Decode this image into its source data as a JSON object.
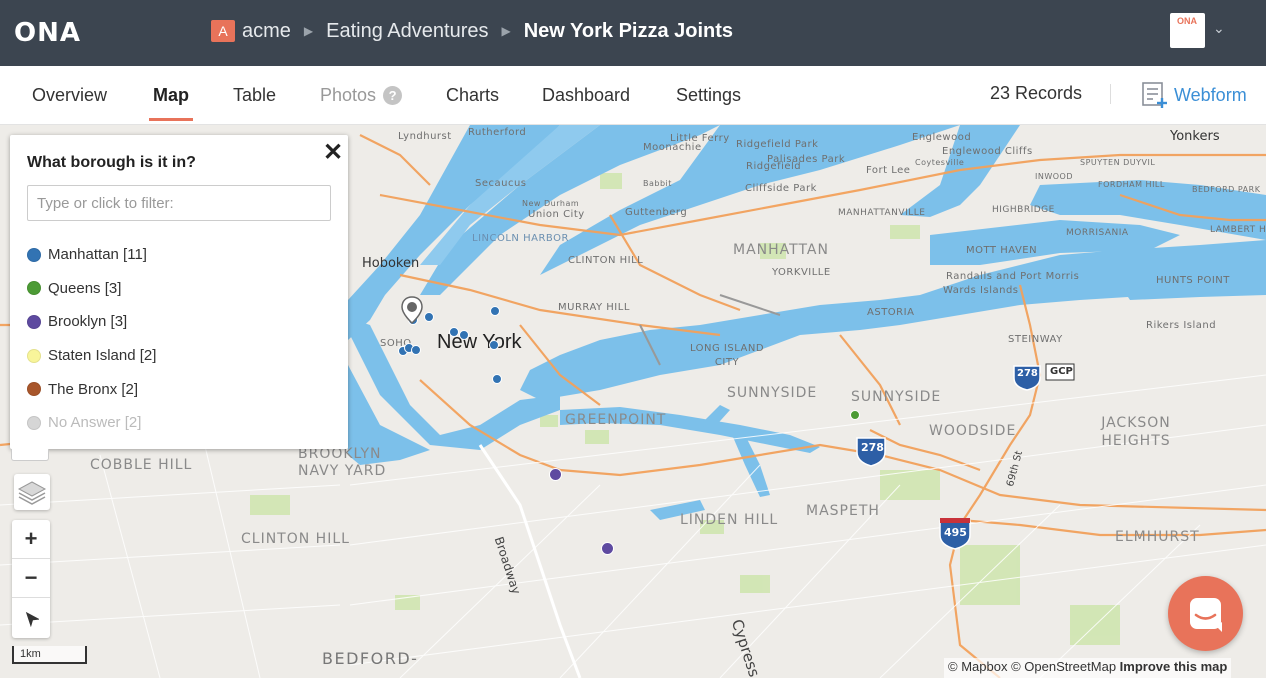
{
  "app": {
    "logo": "ONA",
    "breadcrumbs": {
      "org_initial": "A",
      "org": "acme",
      "project": "Eating Adventures",
      "form": "New York Pizza Joints"
    }
  },
  "tabs": {
    "overview": "Overview",
    "map": "Map",
    "table": "Table",
    "photos": "Photos",
    "photos_help": "?",
    "charts": "Charts",
    "dashboard": "Dashboard",
    "settings": "Settings"
  },
  "records": "23 Records",
  "webform": "Webform",
  "filter": {
    "title": "What borough is it in?",
    "close": "✕",
    "placeholder": "Type or click to filter:",
    "items": [
      {
        "label": "Manhattan [11]",
        "color": "#3273b3"
      },
      {
        "label": "Queens [3]",
        "color": "#4c9b35"
      },
      {
        "label": "Brooklyn [3]",
        "color": "#5e4aa0"
      },
      {
        "label": "Staten Island [2]",
        "color": "#f8f59a"
      },
      {
        "label": "The Bronx [2]",
        "color": "#a8562b"
      },
      {
        "label": "No Answer [2]",
        "color": "#d6d6d6"
      }
    ]
  },
  "map": {
    "city_label": "New York",
    "labels": {
      "lyndhurst": "Lyndhurst",
      "rutherford": "Rutherford",
      "little_ferry": "Little Ferry",
      "moonachie": "Moonachie",
      "ridgefield_park": "Ridgefield Park",
      "englewood": "Englewood",
      "englewood_cliffs": "Englewood Cliffs",
      "yonkers": "Yonkers",
      "ridgefield": "Ridgefield",
      "palisades_park": "Palisades Park",
      "fort_lee": "Fort Lee",
      "coytesville": "Coytesville",
      "secaucus": "Secaucus",
      "babbit": "Babbit",
      "cliffside_park": "Cliffside Park",
      "new_durham": "New Durham",
      "union_city": "Union City",
      "guttenberg": "Guttenberg",
      "manhattanville": "MANHATTANVILLE",
      "highbridge": "HIGHBRIDGE",
      "morrisania": "MORRISANIA",
      "inwood": "INWOOD",
      "spuyten_duyvil": "SPUYTEN DUYVIL",
      "fordham_hill": "FORDHAM HILL",
      "bedford_park": "BEDFORD PARK",
      "lambert_houses": "LAMBERT HOUSES",
      "lincoln_harbor": "LINCOLN HARBOR",
      "hoboken": "Hoboken",
      "clinton_hill_nj": "CLINTON HILL",
      "manhattan": "MANHATTAN",
      "yorkville": "YORKVILLE",
      "mott_haven": "MOTT HAVEN",
      "randalls": "Randalls and Port Morris",
      "wards": "Wards Islands",
      "hunts_point": "HUNTS POINT",
      "murray_hill": "MURRAY HILL",
      "astoria": "ASTORIA",
      "rikers": "Rikers Island",
      "steinway": "STEINWAY",
      "soho": "SOHO",
      "long_island_city": "LONG ISLAND CITY",
      "sunnyside": "SUNNYSIDE",
      "sunnyside2": "SUNNYSIDE",
      "greenpoint": "GREENPOINT",
      "woodside": "WOODSIDE",
      "jackson_heights": "JACKSON HEIGHTS",
      "brooklyn_navy_yard": "BROOKLYN NAVY YARD",
      "cobble_hill": "COBBLE HILL",
      "linden_hill": "LINDEN HILL",
      "maspeth": "MASPETH",
      "elmhurst": "ELMHURST",
      "clinton_hill": "CLINTON HILL",
      "bedford": "BEDFORD-",
      "broadway": "Broadway",
      "cypress": "Cypress",
      "st_69": "69th St",
      "i495": "495",
      "i278": "278",
      "i278b": "278",
      "gcp": "GCP"
    },
    "scale": "1km",
    "attribution_mapbox": "© Mapbox",
    "attribution_osm": "© OpenStreetMap",
    "attribution_improve": "Improve this map",
    "zoom_in": "+",
    "zoom_out": "−"
  }
}
